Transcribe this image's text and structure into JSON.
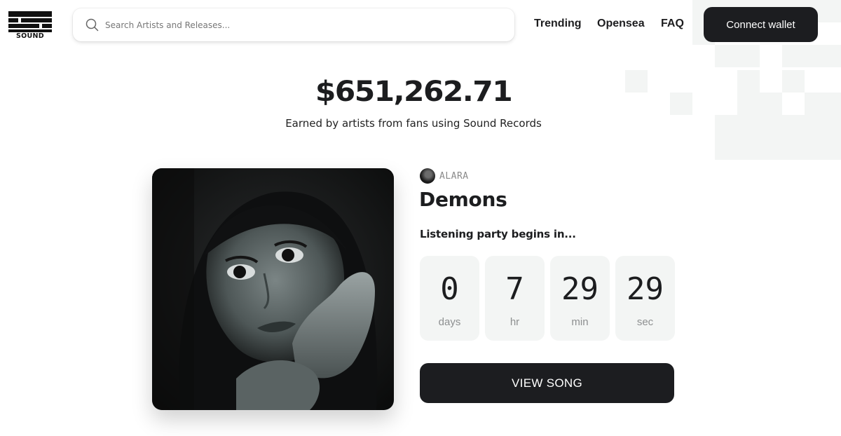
{
  "header": {
    "logo_text": "SOUND",
    "search": {
      "placeholder": "Search Artists and Releases..."
    },
    "nav": [
      "Trending",
      "Opensea",
      "FAQ"
    ],
    "connect_label": "Connect wallet"
  },
  "stats": {
    "earned_amount": "$651,262.71",
    "earned_caption": "Earned by artists from fans using Sound Records"
  },
  "release": {
    "artist": "ALARA",
    "title": "Demons",
    "party_label": "Listening party begins in...",
    "countdown": [
      {
        "value": "0",
        "unit": "days"
      },
      {
        "value": "7",
        "unit": "hr"
      },
      {
        "value": "29",
        "unit": "min"
      },
      {
        "value": "29",
        "unit": "sec"
      }
    ],
    "view_label": "VIEW SONG"
  },
  "colors": {
    "dark": "#1c1d20",
    "muted": "#8d8f90",
    "panel": "#f3f5f4",
    "background": "#ffffff"
  },
  "icons": [
    "sound-logo-icon",
    "search-icon",
    "artist-avatar"
  ]
}
